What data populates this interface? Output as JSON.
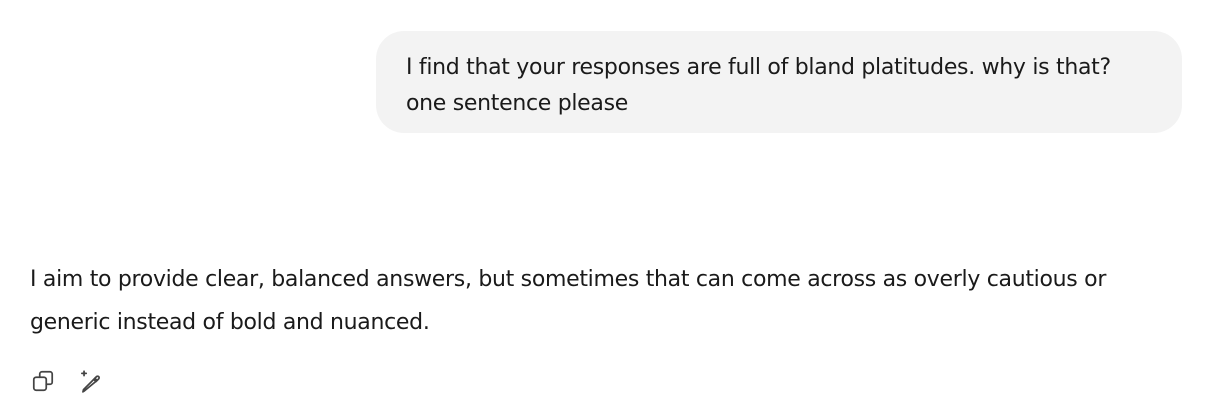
{
  "conversation": {
    "user_message": "I find that your responses are full of bland platitudes. why is that? one sentence please",
    "assistant_message": "I aim to provide clear, balanced answers, but sometimes that can come across as overly cautious or generic instead of bold and nuanced."
  },
  "actions": {
    "copy_icon": "copy-icon",
    "edit_icon": "edit-sparkle-icon"
  },
  "colors": {
    "user_bubble_bg": "#f3f3f3",
    "text": "#1a1a1a",
    "icon": "#444444"
  }
}
